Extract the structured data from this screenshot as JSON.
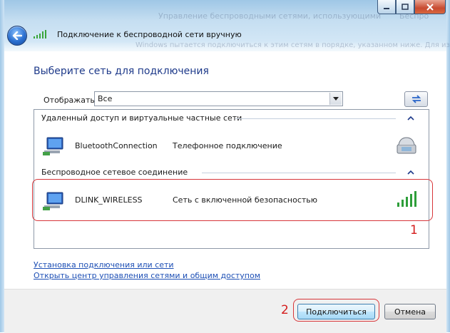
{
  "window": {
    "title": "Подключение к беспроводной сети вручную",
    "ghost_text_1": "Управление беспроводными сетями, использующими",
    "ghost_text_2": "Беспро",
    "ghost_text_3": "Windows пытается подключиться к этим сетям в порядке, указанном ниже. Для изм"
  },
  "heading": "Выберите сеть для подключения",
  "filter": {
    "label": "Отображать",
    "value": "Все"
  },
  "groups": [
    {
      "header": "Удаленный доступ и виртуальные частные сети",
      "networks": [
        {
          "name": "BluetoothConnection",
          "description": "Телефонное подключение",
          "icon": "phone-modem-icon"
        }
      ]
    },
    {
      "header": "Беспроводное сетевое соединение",
      "networks": [
        {
          "name": "DLINK_WIRELESS",
          "description": "Сеть с включенной безопасностью",
          "icon": "signal-strength-icon"
        }
      ]
    }
  ],
  "annotations": {
    "first": "1",
    "second": "2"
  },
  "links": {
    "setup": "Установка подключения или сети",
    "network_center": "Открыть центр управления сетями и общим доступом"
  },
  "buttons": {
    "connect": "Подключиться",
    "cancel": "Отмена"
  },
  "colors": {
    "heading": "#1e3a8a",
    "link": "#1d4fb5",
    "annotation": "#d41c1c"
  }
}
